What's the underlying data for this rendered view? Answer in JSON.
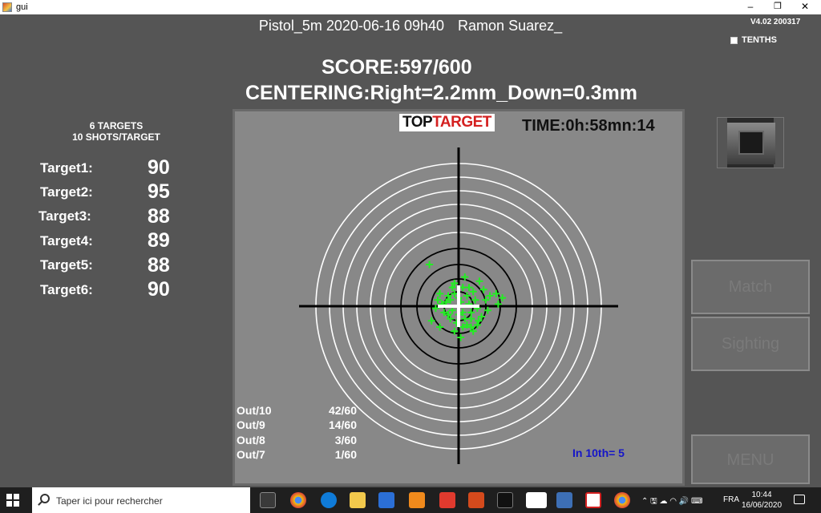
{
  "window": {
    "title": "gui",
    "minimize": "–",
    "maximize": "❐",
    "close": "✕"
  },
  "header": {
    "session": "Pistol_5m 2020-06-16 09h40",
    "shooter": "Ramon Suarez_",
    "version": "V4.02 200317",
    "tenths_label": "TENTHS"
  },
  "score": "SCORE:597/600",
  "centering": "CENTERING:Right=2.2mm_Down=0.3mm",
  "summary": {
    "line1": "6 TARGETS",
    "line2": "10 SHOTS/TARGET"
  },
  "targets": [
    {
      "label": "Target1:",
      "score": "90"
    },
    {
      "label": "Target2:",
      "score": "95"
    },
    {
      "label": "Target3:",
      "score": "88"
    },
    {
      "label": "Target4:",
      "score": "89"
    },
    {
      "label": "Target5:",
      "score": "88"
    },
    {
      "label": "Target6:",
      "score": "90"
    }
  ],
  "logo": {
    "part1": "TOP",
    "part2": "TARGET"
  },
  "time": "TIME:0h:58mn:14",
  "stats": [
    {
      "label": "Out/10",
      "value": "42/60"
    },
    {
      "label": "Out/9",
      "value": "14/60"
    },
    {
      "label": "Out/8",
      "value": "3/60"
    },
    {
      "label": "Out/7",
      "value": "1/60"
    }
  ],
  "in_tenth": "In 10th= 5",
  "buttons": {
    "match": "Match",
    "sighting": "Sighting",
    "menu": "MENU"
  },
  "colors": {
    "shot": "#22ee22",
    "background": "#555555",
    "panel": "#888888",
    "in_tenth": "#1515c8"
  },
  "taskbar": {
    "search_placeholder": "Taper ici pour rechercher",
    "language": "FRA",
    "time": "10:44",
    "date": "16/06/2020"
  },
  "shots": [
    [
      -0.3,
      -0.2
    ],
    [
      0.4,
      0.5
    ],
    [
      -1.4,
      2.0
    ],
    [
      1.8,
      0.6
    ],
    [
      2.1,
      0.4
    ],
    [
      1.9,
      0.1
    ],
    [
      -1.3,
      -0.7
    ],
    [
      -0.9,
      -1.0
    ],
    [
      0.7,
      -1.2
    ],
    [
      0.1,
      -1.5
    ],
    [
      0.9,
      -0.9
    ],
    [
      0.6,
      -0.6
    ],
    [
      -0.4,
      0.3
    ],
    [
      -0.2,
      0.6
    ],
    [
      0.2,
      0.9
    ],
    [
      0.3,
      1.4
    ],
    [
      1.0,
      1.2
    ],
    [
      1.2,
      0.8
    ],
    [
      1.4,
      -0.2
    ],
    [
      1.1,
      -0.5
    ],
    [
      -0.6,
      0.2
    ],
    [
      -0.8,
      0.1
    ],
    [
      -1.0,
      0.3
    ],
    [
      -0.5,
      -0.4
    ],
    [
      -0.1,
      -0.8
    ],
    [
      0.2,
      -0.3
    ],
    [
      0.5,
      0.1
    ],
    [
      0.8,
      0.3
    ],
    [
      0.9,
      -0.1
    ],
    [
      -0.3,
      0.9
    ],
    [
      0.0,
      0.4
    ],
    [
      -0.7,
      -0.3
    ],
    [
      0.4,
      -0.9
    ],
    [
      0.6,
      -1.0
    ],
    [
      -0.2,
      -1.2
    ],
    [
      0.3,
      -0.6
    ],
    [
      0.7,
      0.7
    ],
    [
      1.3,
      0.3
    ],
    [
      -1.1,
      -0.1
    ],
    [
      -0.4,
      -0.6
    ],
    [
      0.1,
      0.2
    ],
    [
      0.6,
      -0.3
    ],
    [
      -0.5,
      0.5
    ],
    [
      0.2,
      -1.0
    ],
    [
      0.95,
      -0.7
    ],
    [
      -0.2,
      1.1
    ],
    [
      0.5,
      0.9
    ],
    [
      1.5,
      0.5
    ],
    [
      -0.9,
      0.6
    ],
    [
      0.0,
      -0.4
    ]
  ]
}
